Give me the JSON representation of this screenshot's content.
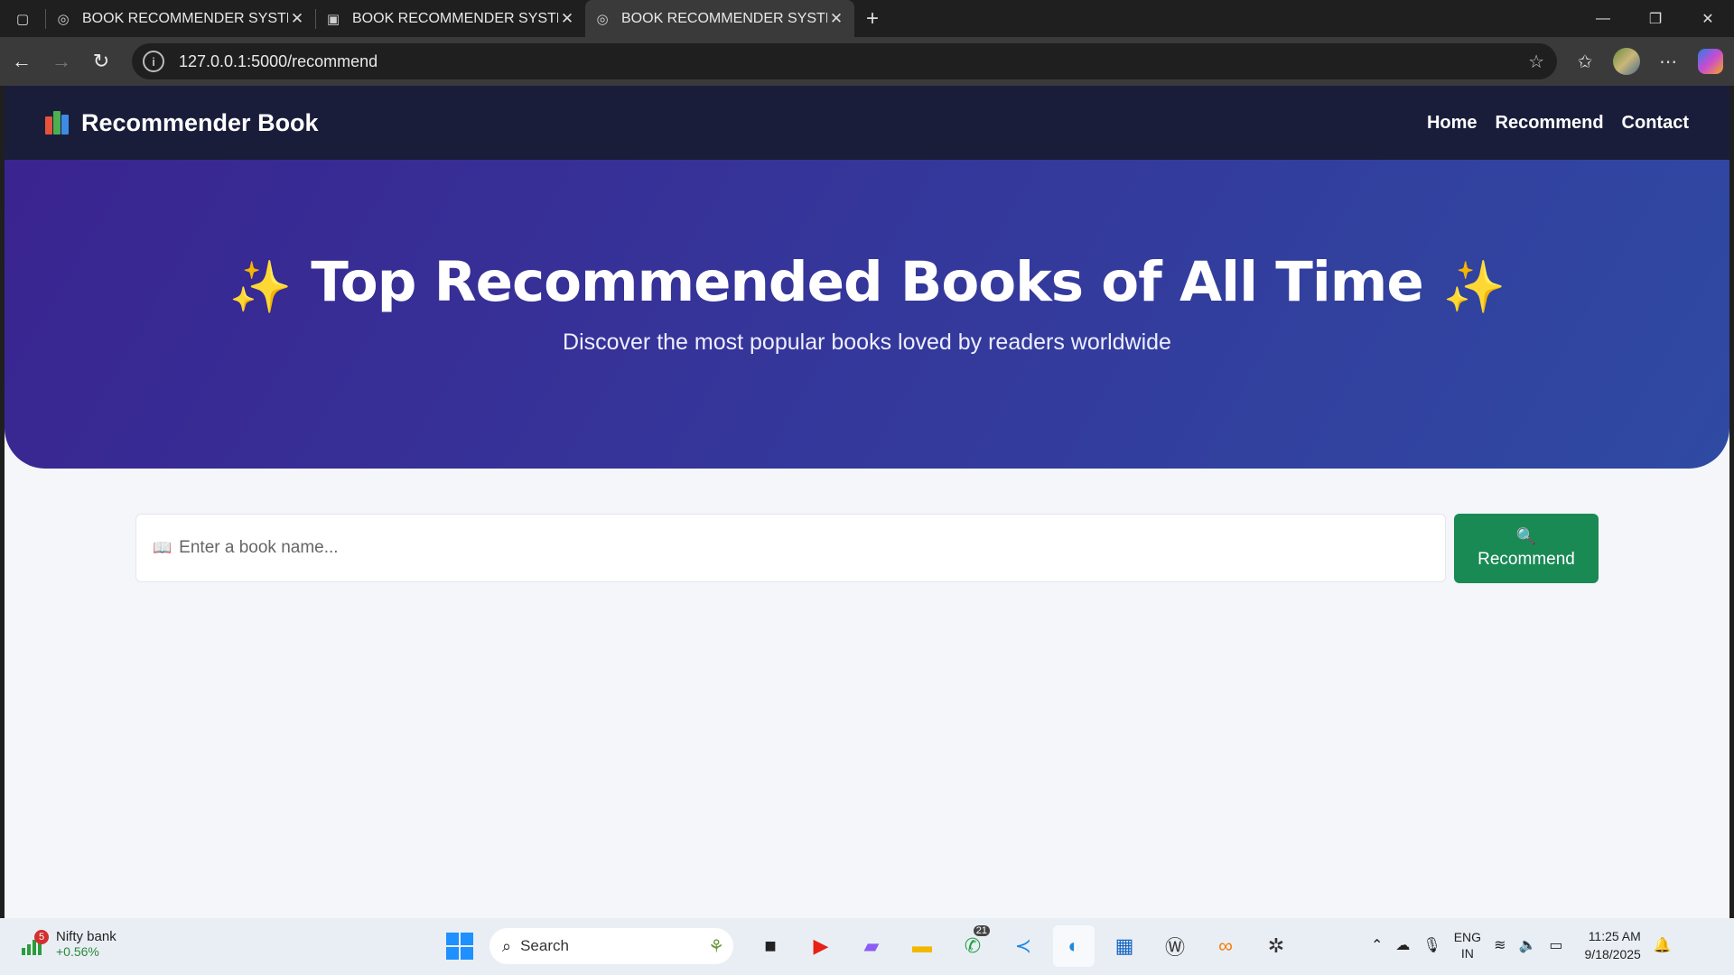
{
  "browser": {
    "tabs": [
      {
        "title": "BOOK RECOMMENDER SYSTEM",
        "icon": "globe-icon"
      },
      {
        "title": "BOOK RECOMMENDER SYSTEM",
        "icon": "terminal-icon"
      },
      {
        "title": "BOOK RECOMMENDER SYSTEM",
        "icon": "globe-icon",
        "active": true
      }
    ],
    "url": "127.0.0.1:5000/recommend"
  },
  "site": {
    "brand": "Recommender Book",
    "nav": [
      "Home",
      "Recommend",
      "Contact"
    ],
    "hero_title": "Top Recommended Books of All Time",
    "hero_sparkle": "✨",
    "hero_subtitle": "Discover the most popular books loved by readers worldwide",
    "search_placeholder": "Enter a book name...",
    "search_icon": "📖",
    "button_icon": "🔍",
    "button_label": "Recommend",
    "colors": {
      "nav": "#1a1d3a",
      "hero_start": "#3a2490",
      "hero_end": "#2f4aa2",
      "button": "#1a8a55"
    }
  },
  "taskbar": {
    "widget_badge": "5",
    "widget_title": "Nifty bank",
    "widget_value": "+0.56%",
    "search_label": "Search",
    "whatsapp_count": "21",
    "lang_top": "ENG",
    "lang_bottom": "IN",
    "time": "11:25 AM",
    "date": "9/18/2025"
  }
}
